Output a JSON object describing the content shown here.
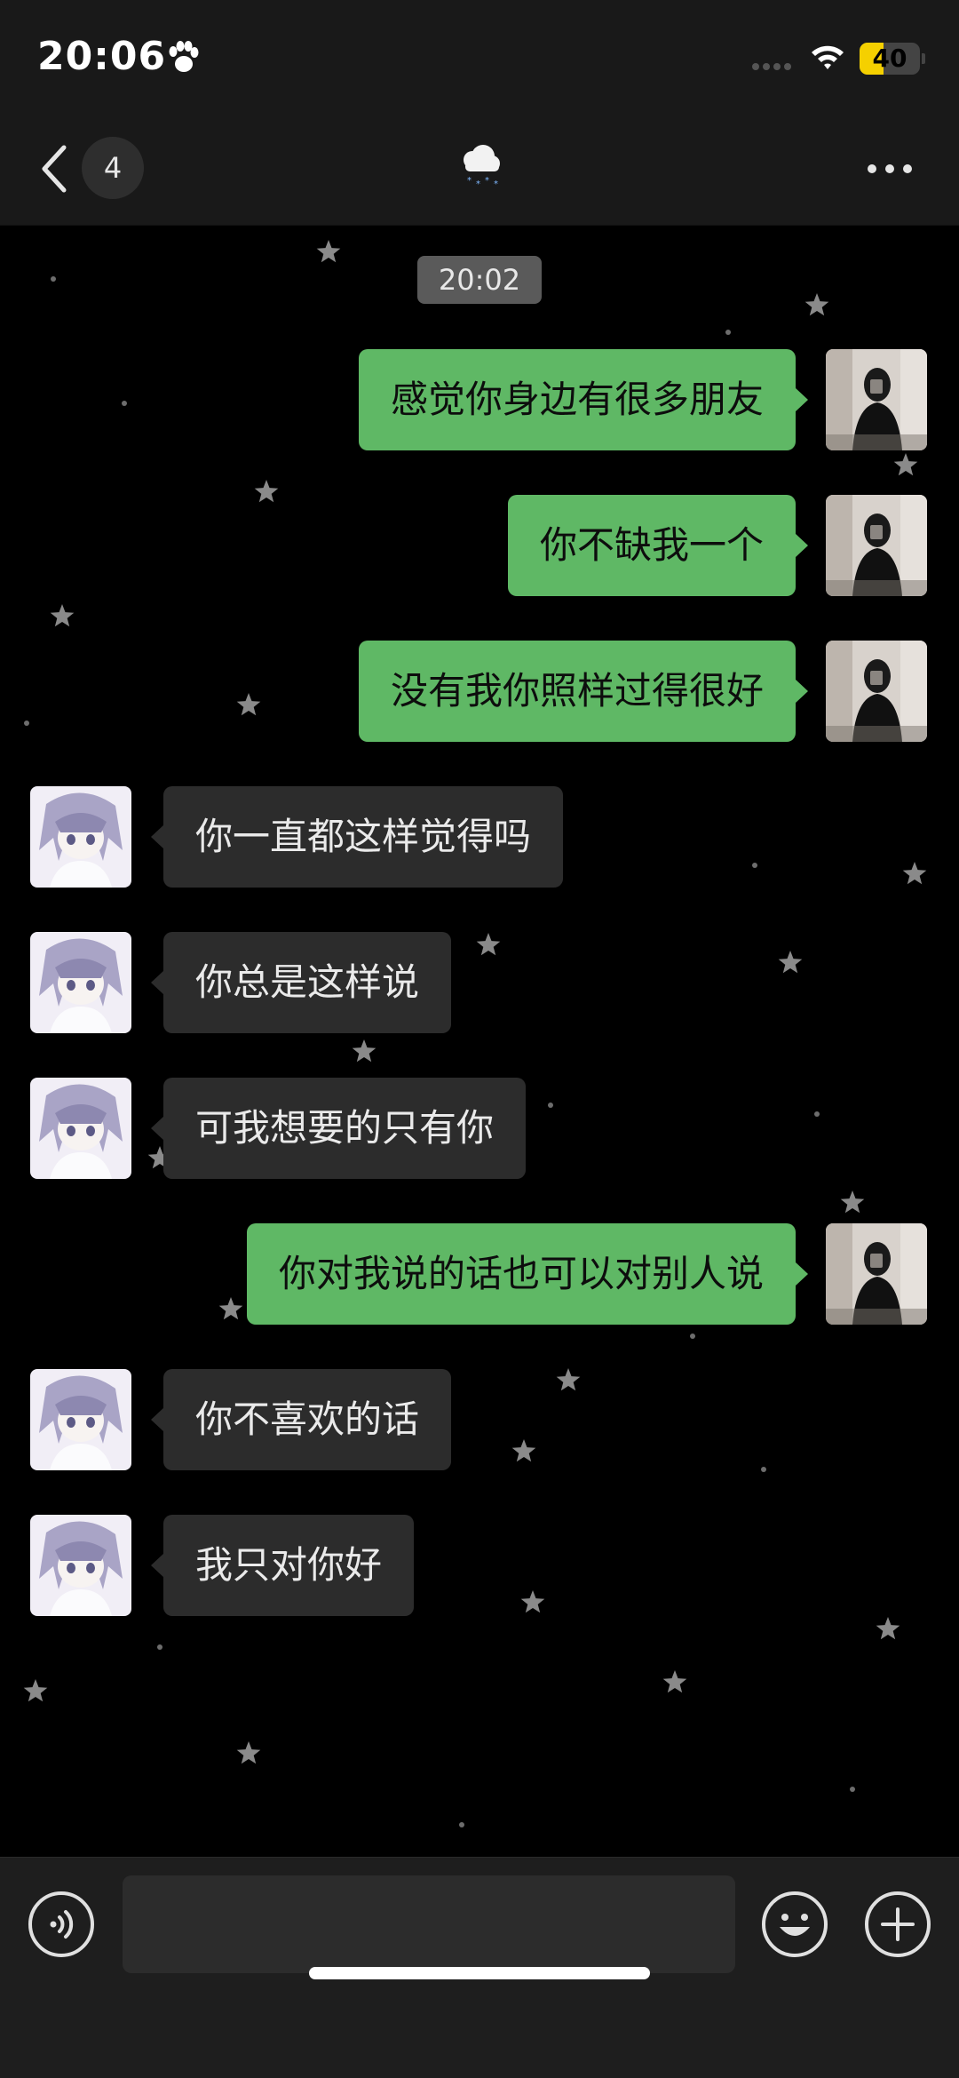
{
  "status_bar": {
    "time": "20:06",
    "battery": "40",
    "battery_level": 0.4
  },
  "nav": {
    "unread_count": "4",
    "title_icon": "snow-cloud-icon"
  },
  "chat": {
    "timestamp": "20:02",
    "messages": [
      {
        "side": "out",
        "text": "感觉你身边有很多朋友"
      },
      {
        "side": "out",
        "text": "你不缺我一个"
      },
      {
        "side": "out",
        "text": "没有我你照样过得很好"
      },
      {
        "side": "in",
        "text": "你一直都这样觉得吗"
      },
      {
        "side": "in",
        "text": "你总是这样说"
      },
      {
        "side": "in",
        "text": "可我想要的只有你"
      },
      {
        "side": "out",
        "text": "你对我说的话也可以对别人说"
      },
      {
        "side": "in",
        "text": "你不喜欢的话"
      },
      {
        "side": "in",
        "text": "我只对你好"
      }
    ]
  },
  "input_bar": {
    "message_value": "",
    "voice_icon": "voice-icon",
    "emoji_icon": "emoji-icon",
    "plus_icon": "plus-icon"
  },
  "colors": {
    "outgoing_bubble": "#5fb865",
    "incoming_bubble": "#2c2c2c",
    "battery_fill": "#f5d000",
    "background": "#000000"
  }
}
